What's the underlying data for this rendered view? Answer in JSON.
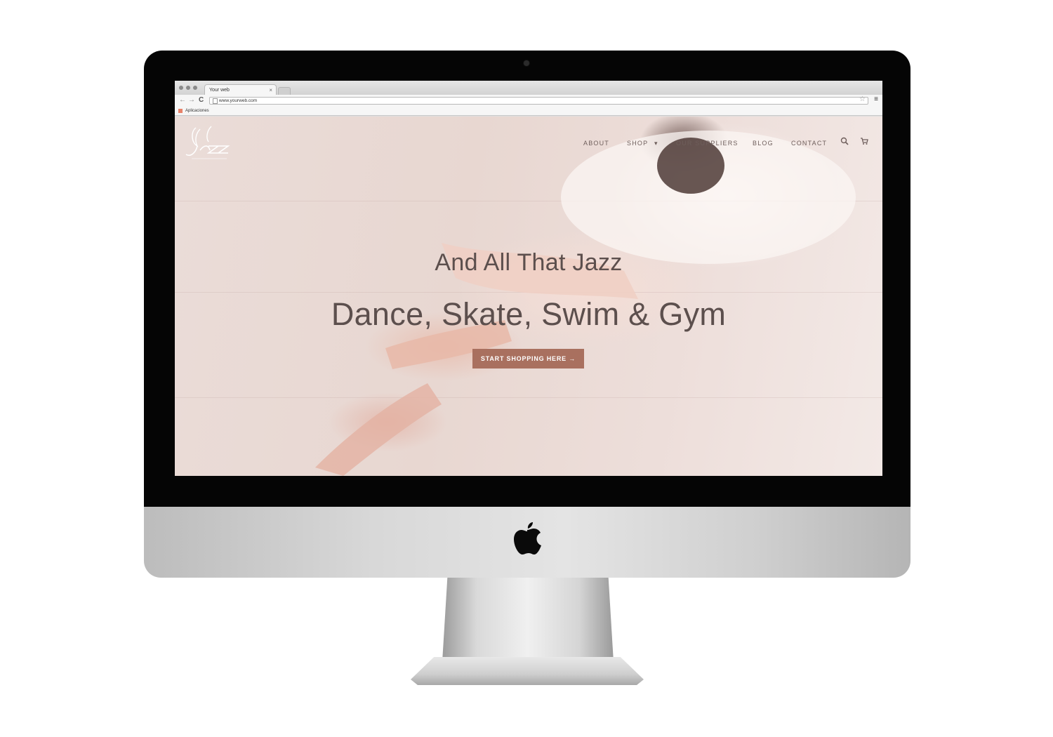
{
  "browser": {
    "tab_title": "Your web",
    "tab_close": "×",
    "url": "www.yourweb.com",
    "bookmarks_label": "Aplicaciones",
    "star_icon": "☆",
    "menu_icon": "≡",
    "nav_back": "←",
    "nav_forward": "→",
    "nav_reload": "C"
  },
  "site": {
    "nav": {
      "items": [
        "ABOUT",
        "SHOP",
        "OUR SUPPLIERS",
        "BLOG",
        "CONTACT"
      ],
      "shop_caret": "▾"
    },
    "hero": {
      "subtitle": "And All That Jazz",
      "title": "Dance, Skate, Swim & Gym",
      "cta_label": "START SHOPPING HERE →"
    },
    "icons": [
      "search-icon",
      "cart-icon",
      "logo-jazz"
    ]
  },
  "colors": {
    "cta_background": "#a9705f",
    "hero_text": "#5c4f4d",
    "nav_text": "#6e5e5b"
  }
}
